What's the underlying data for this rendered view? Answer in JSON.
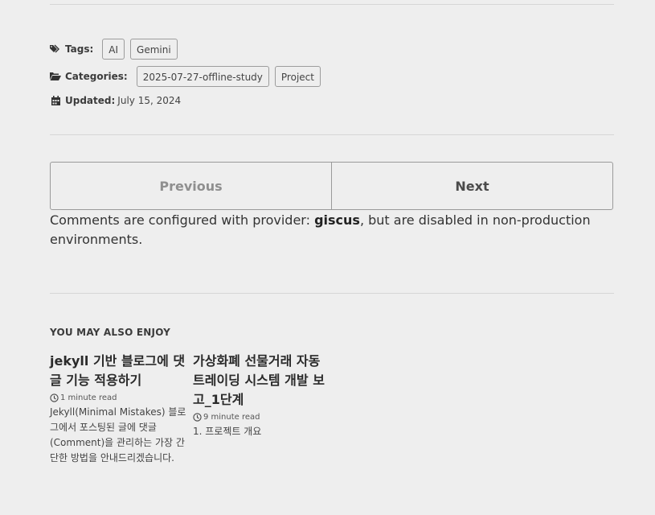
{
  "meta": {
    "tags_label": "Tags:",
    "tags": [
      "AI",
      "Gemini"
    ],
    "categories_label": "Categories:",
    "categories": [
      "2025-07-27-offline-study",
      "Project"
    ],
    "updated_label": "Updated:",
    "updated_value": "July 15, 2024"
  },
  "pager": {
    "previous_label": "Previous",
    "next_label": "Next"
  },
  "comments": {
    "text_before": "Comments are configured with provider: ",
    "provider": "giscus",
    "text_after": ", but are disabled in non-production environments."
  },
  "related": {
    "heading": "YOU MAY ALSO ENJOY",
    "posts": [
      {
        "title": "jekyll 기반 블로그에 댓글 기능 적용하기",
        "read_time": "1 minute read",
        "excerpt": "Jekyll(Minimal Mistakes) 블로그에서 포스팅된 글에 댓글(Comment)을 관리하는 가장 간단한 방법을 안내드리겠습니다."
      },
      {
        "title": "가상화폐 선물거래 자동 트레이딩 시스템 개발 보고_1단계",
        "read_time": "9 minute read",
        "excerpt": "1. 프로젝트 개요"
      }
    ]
  }
}
